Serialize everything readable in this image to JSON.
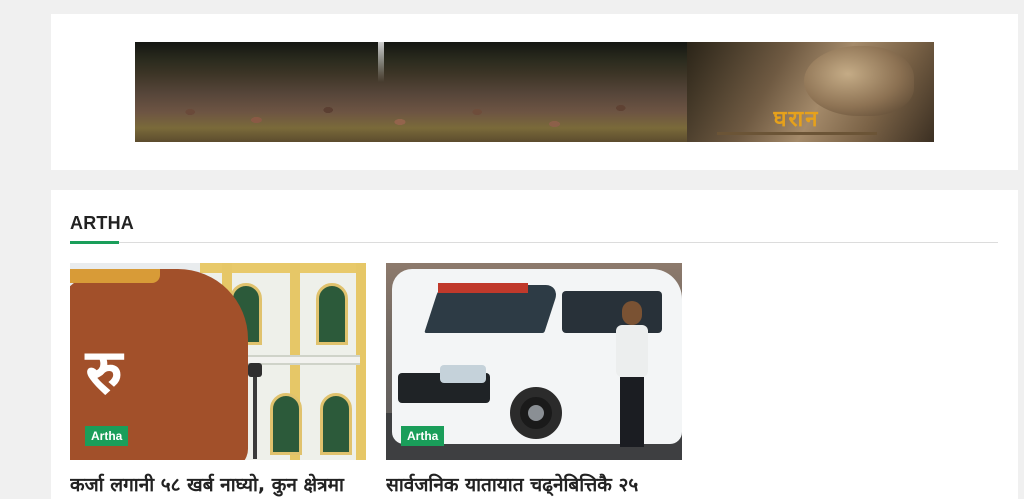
{
  "ad": {
    "poster_title": "घरान"
  },
  "section": {
    "title": "ARTHA"
  },
  "cards": [
    {
      "tag": "Artha",
      "headline": "कर्जा लगानी ५८ खर्ब नाघ्यो, कुन क्षेत्रमा",
      "image_glyph": "रु"
    },
    {
      "tag": "Artha",
      "headline": "सार्वजनिक यातायात चढ्नेबित्तिकै २५"
    }
  ],
  "colors": {
    "accent": "#1a9e5a",
    "page_bg": "#f0f0f0",
    "card_bg": "#ffffff",
    "heading_text": "#222222",
    "ad_title": "#e6a11b"
  }
}
